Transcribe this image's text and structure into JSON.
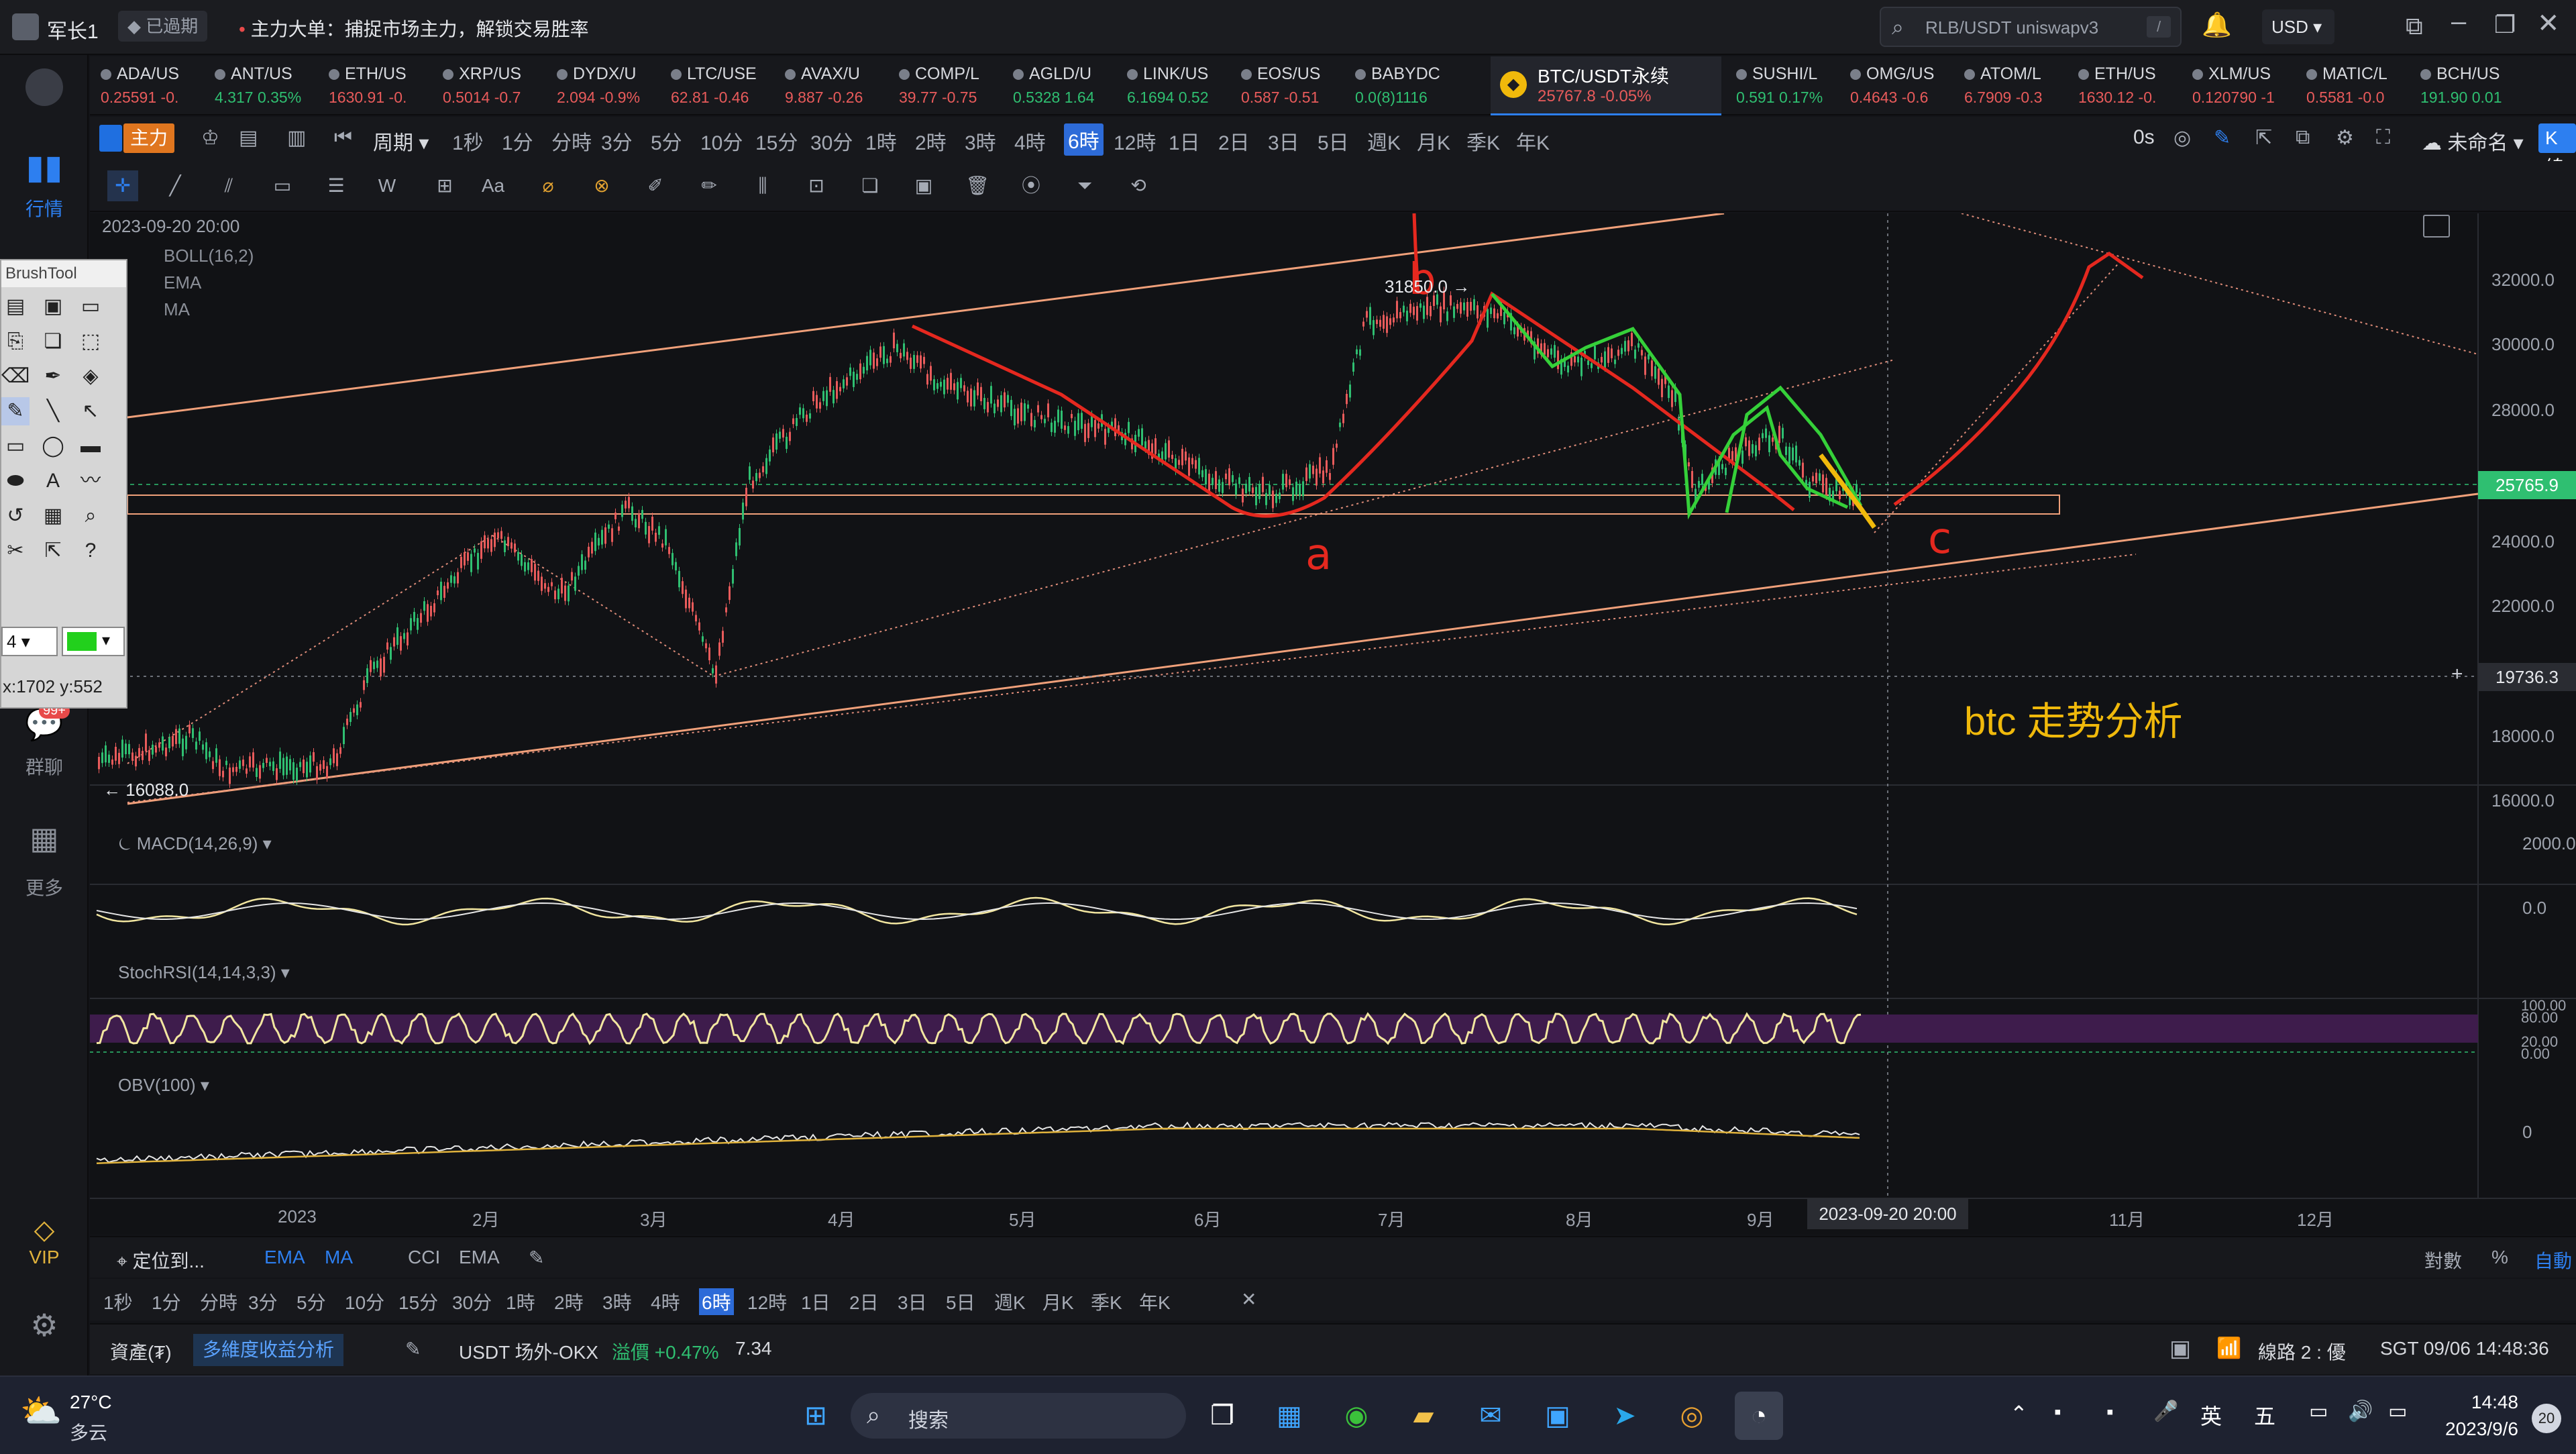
{
  "titlebar": {
    "user": "军长1",
    "status": "已過期",
    "announce": "主力大单：捕捉市场主力，解锁交易胜率",
    "search_placeholder": "RLB/USDT uniswapv3",
    "currency": "USD"
  },
  "leftbar": {
    "market": "行情",
    "group": "群聊",
    "more": "更多",
    "vip": "VIP",
    "badge": "99+"
  },
  "tickers": [
    {
      "sym": "ADA/US",
      "price": "0.25591",
      "chg": "-0.",
      "up": false
    },
    {
      "sym": "ANT/US",
      "price": "4.317",
      "chg": "0.35%",
      "up": true
    },
    {
      "sym": "ETH/US",
      "price": "1630.91",
      "chg": "-0.",
      "up": false
    },
    {
      "sym": "XRP/US",
      "price": "0.5014",
      "chg": "-0.7",
      "up": false
    },
    {
      "sym": "DYDX/U",
      "price": "2.094",
      "chg": "-0.9%",
      "up": false
    },
    {
      "sym": "LTC/USE",
      "price": "62.81",
      "chg": "-0.46",
      "up": false
    },
    {
      "sym": "AVAX/U",
      "price": "9.887",
      "chg": "-0.26",
      "up": false
    },
    {
      "sym": "COMP/L",
      "price": "39.77",
      "chg": "-0.75",
      "up": false
    },
    {
      "sym": "AGLD/U",
      "price": "0.5328",
      "chg": "1.64",
      "up": true
    },
    {
      "sym": "LINK/US",
      "price": "6.1694",
      "chg": "0.52",
      "up": true
    },
    {
      "sym": "EOS/US",
      "price": "0.587",
      "chg": "-0.51",
      "up": false
    },
    {
      "sym": "BABYDC",
      "price": "0.0(8)1116",
      "chg": "",
      "up": true
    }
  ],
  "active_ticker": {
    "sym": "BTC/USDT永续",
    "price": "25767.8",
    "chg": "-0.05%"
  },
  "tickers_right": [
    {
      "sym": "SUSHI/L",
      "price": "0.591",
      "chg": "0.17%",
      "up": true
    },
    {
      "sym": "OMG/US",
      "price": "0.4643",
      "chg": "-0.6",
      "up": false
    },
    {
      "sym": "ATOM/L",
      "price": "6.7909",
      "chg": "-0.3",
      "up": false
    },
    {
      "sym": "ETH/US",
      "price": "1630.12",
      "chg": "-0.",
      "up": false
    },
    {
      "sym": "XLM/US",
      "price": "0.120790",
      "chg": "-1",
      "up": false
    },
    {
      "sym": "MATIC/L",
      "price": "0.5581",
      "chg": "-0.0",
      "up": false
    },
    {
      "sym": "BCH/US",
      "price": "191.90",
      "chg": "0.01",
      "up": true
    }
  ],
  "periodbar": {
    "main": "主力",
    "period": "周期",
    "items": [
      "1秒",
      "1分",
      "分時",
      "3分",
      "5分",
      "10分",
      "15分",
      "30分",
      "1時",
      "2時",
      "3時",
      "4時",
      "6時",
      "12時",
      "1日",
      "2日",
      "3日",
      "5日",
      "週K",
      "月K",
      "季K",
      "年K"
    ],
    "active": "6時",
    "delay": "0s",
    "unnamed": "未命名",
    "kline": "K線分析"
  },
  "chart": {
    "datetime": "2023-09-20 20:00",
    "indicators": [
      "BOLL(16,2)",
      "EMA",
      "MA"
    ],
    "price_labels": [
      "32000.0",
      "30000.0",
      "28000.0",
      "24000.0",
      "22000.0",
      "18000.0",
      "16000.0"
    ],
    "current_price": "25765.9",
    "cross_price": "19736.3",
    "high_label": "31850.0",
    "low_label": "16088.0",
    "months": [
      "2023",
      "2月",
      "3月",
      "4月",
      "5月",
      "6月",
      "7月",
      "8月",
      "9月",
      "11月",
      "12月"
    ],
    "cursor_time": "2023-09-20 20:00",
    "annotation": "btc 走势分析",
    "marks": {
      "a": "a",
      "b": "b",
      "c": "c"
    },
    "macd_label": "MACD(14,26,9)",
    "macd_levels": [
      "2000.0",
      "0.0"
    ],
    "stoch_label": "StochRSI(14,14,3,3)",
    "stoch_levels": [
      "100.00",
      "80.00",
      "20.00",
      "0.00"
    ],
    "obv_label": "OBV(100)",
    "obv_level": "0"
  },
  "brushtool": {
    "title": "BrushTool",
    "size": "4",
    "coords": "x:1702 y:552"
  },
  "bottombar1": {
    "locate": "定位到...",
    "ema": "EMA",
    "ma": "MA",
    "cci": "CCI",
    "ema2": "EMA",
    "log": "對數",
    "pct": "%",
    "auto": "自動"
  },
  "bottombar2": {
    "items": [
      "1秒",
      "1分",
      "分時",
      "3分",
      "5分",
      "10分",
      "15分",
      "30分",
      "1時",
      "2時",
      "3時",
      "4時",
      "6時",
      "12時",
      "1日",
      "2日",
      "3日",
      "5日",
      "週K",
      "月K",
      "季K",
      "年K"
    ],
    "active": "6時"
  },
  "statusbar": {
    "assets": "資產(₮)",
    "analysis": "多維度收益分析",
    "usdt": "USDT 场外-OKX",
    "premium_label": "溢價",
    "premium": "+0.47%",
    "premium_val": "7.34",
    "network": "線路 2 : 優",
    "time": "SGT 09/06 14:48:36"
  },
  "taskbar": {
    "temp": "27°C",
    "weather": "多云",
    "search": "搜索",
    "time": "14:48",
    "date": "2023/9/6",
    "lang": "英",
    "ime": "五",
    "notif": "20"
  }
}
